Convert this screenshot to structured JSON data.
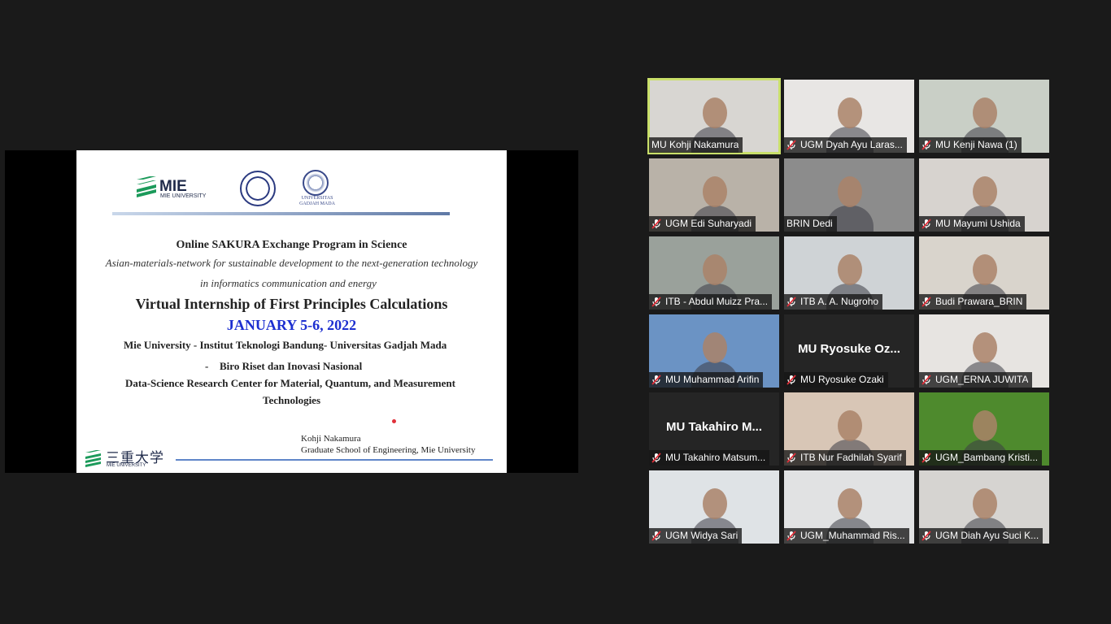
{
  "slide": {
    "logo_mie": "MIE UNIVERSITY",
    "logo_ugm": "UNIVERSITAS GADJAH MADA",
    "title1": "Online SAKURA Exchange Program in Science",
    "subtitle1": "Asian-materials-network for sustainable development to the next-generation technology",
    "subtitle2": "in informatics communication and energy",
    "title2": "Virtual Internship of First Principles Calculations",
    "date": "JANUARY 5-6, 2022",
    "line_univ": "Mie University - Institut Teknologi Bandung- Universitas Gadjah Mada",
    "line_brin_bullet": "-",
    "line_brin": "Biro Riset dan Inovasi Nasional",
    "line_center1": "Data-Science Research Center for Material, Quantum, and Measurement",
    "line_center2": "Technologies",
    "author": "Kohji Nakamura",
    "affiliation": "Graduate School of Engineering, Mie University",
    "footer_logo_jp": "三重大学",
    "footer_logo_en": "MIE UNIVERSITY",
    "accent": "#1d2fd0"
  },
  "participants": [
    {
      "name": "MU Kohji Nakamura",
      "muted": false,
      "active": true,
      "video": true,
      "bg": "#d8d6d2"
    },
    {
      "name": "UGM Dyah Ayu Laras...",
      "muted": true,
      "video": true,
      "bg": "#e8e6e4"
    },
    {
      "name": "MU Kenji Nawa (1)",
      "muted": true,
      "video": true,
      "bg": "#c9cfc6"
    },
    {
      "name": "UGM Edi Suharyadi",
      "muted": true,
      "video": true,
      "bg": "#b9b2a8"
    },
    {
      "name": "BRIN Dedi",
      "muted": false,
      "video": true,
      "bg": "#8c8c8c"
    },
    {
      "name": "MU Mayumi Ushida",
      "muted": true,
      "video": true,
      "bg": "#d7d3cf"
    },
    {
      "name": "ITB - Abdul Muizz Pra...",
      "muted": true,
      "video": true,
      "bg": "#9aa19b"
    },
    {
      "name": "ITB A. A. Nugroho",
      "muted": true,
      "video": true,
      "bg": "#cfd3d6"
    },
    {
      "name": "Budi Prawara_BRIN",
      "muted": true,
      "video": true,
      "bg": "#d9d4cc"
    },
    {
      "name": "MU Muhammad Arifin",
      "muted": true,
      "video": true,
      "bg": "#6b93c4"
    },
    {
      "name": "MU Ryosuke Ozaki",
      "display": "MU Ryosuke Oz...",
      "muted": true,
      "video": false,
      "bg": "#252525"
    },
    {
      "name": "UGM_ERNA JUWITA",
      "muted": true,
      "video": true,
      "bg": "#e7e4e1"
    },
    {
      "name": "MU Takahiro Matsum...",
      "display": "MU Takahiro M...",
      "muted": true,
      "video": false,
      "bg": "#252525"
    },
    {
      "name": "ITB Nur Fadhilah Syarif",
      "muted": true,
      "video": true,
      "bg": "#d8c6b6"
    },
    {
      "name": "UGM_Bambang Kristi...",
      "muted": true,
      "video": true,
      "bg": "#4e8a2d"
    },
    {
      "name": "UGM Widya Sari",
      "muted": true,
      "video": true,
      "bg": "#dfe3e6"
    },
    {
      "name": "UGM_Muhammad Ris...",
      "muted": true,
      "video": true,
      "bg": "#e1e2e3"
    },
    {
      "name": "UGM Diah Ayu Suci K...",
      "muted": true,
      "video": true,
      "bg": "#d6d4d1"
    }
  ]
}
